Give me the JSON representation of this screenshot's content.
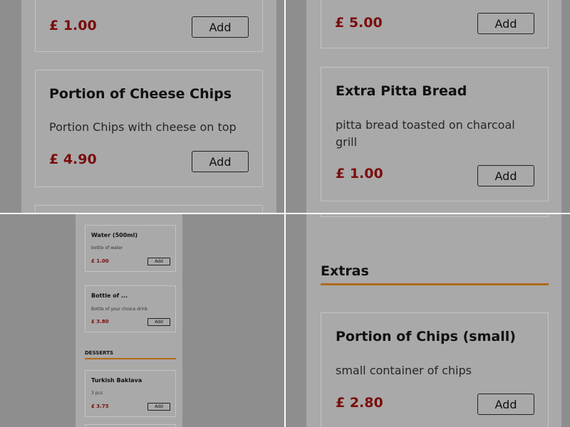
{
  "q1": {
    "top_card": {
      "price": "£ 1.00",
      "add_label": "Add"
    },
    "cheese_chips": {
      "name": "Portion of Cheese Chips",
      "description": "Portion Chips with cheese on top",
      "price": "£ 4.90",
      "add_label": "Add"
    }
  },
  "q2": {
    "top_card": {
      "price": "£ 5.00",
      "add_label": "Add"
    },
    "pitta": {
      "name": "Extra Pitta Bread",
      "description": "pitta bread toasted on charcoal grill",
      "price": "£ 1.00",
      "add_label": "Add"
    }
  },
  "q3": {
    "water": {
      "name": "Water (500ml)",
      "description": "bottle of water",
      "price": "£ 1.00",
      "add_label": "Add"
    },
    "bottle": {
      "name": "Bottle of ...",
      "description": "Bottle of your choice drink",
      "price": "£ 3.80",
      "add_label": "Add"
    },
    "desserts_title": "DESSERTS",
    "baklava": {
      "name": "Turkish Baklava",
      "description": "3 pcs",
      "price": "£ 3.75",
      "add_label": "Add"
    }
  },
  "q4": {
    "extras_title": "Extras",
    "chips_small": {
      "name": "Portion of Chips (small)",
      "description": "small container of chips",
      "price": "£ 2.80",
      "add_label": "Add"
    }
  },
  "colors": {
    "price": "#7b0c0c",
    "accent_rule": "#b06a1a",
    "overlay_bg": "#8e8e8e"
  }
}
